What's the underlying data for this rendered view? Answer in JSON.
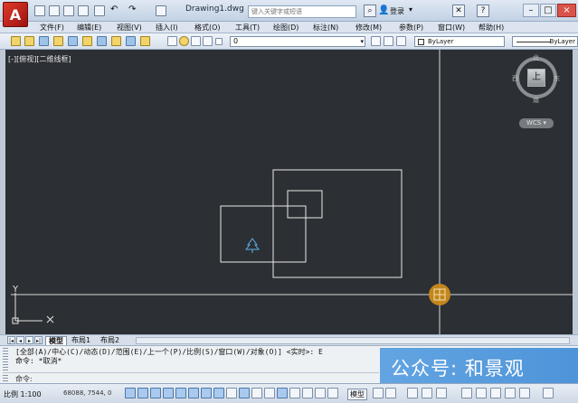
{
  "app": {
    "logo": "A",
    "document_title": "Drawing1.dwg"
  },
  "search": {
    "placeholder": "键入关键字或短语"
  },
  "user": {
    "login_label": "登录",
    "icon": "user-icon"
  },
  "menu": [
    "文件(F)",
    "编辑(E)",
    "视图(V)",
    "插入(I)",
    "格式(O)",
    "工具(T)",
    "绘图(D)",
    "标注(N)",
    "修改(M)",
    "参数(P)",
    "窗口(W)",
    "帮助(H)"
  ],
  "toolbar": {
    "layer_value": "0",
    "color_value": "ByLayer",
    "linetype_value": "ByLayer"
  },
  "viewport": {
    "label": "[-][俯视][二维线框]"
  },
  "viewcube": {
    "north": "北",
    "south": "南",
    "east": "东",
    "west": "西",
    "face": "上",
    "wcs_label": "WCS"
  },
  "ucs": {
    "y_label": "Y",
    "x_label": "X"
  },
  "layout_tabs": [
    "模型",
    "布局1",
    "布局2"
  ],
  "command": {
    "history": [
      "[全部(A)/中心(C)/动态(D)/范围(E)/上一个(P)/比例(S)/窗口(W)/对象(O)] <实时>: E",
      "命令: *取消*"
    ],
    "prompt": "命令:",
    "input_value": ""
  },
  "statusbar": {
    "scale": "比例 1:100",
    "coordinates": "68088, 7544, 0",
    "model_label": "模型"
  },
  "watermark": {
    "text": "公众号: 和景观"
  },
  "colors": {
    "canvas_bg": "#2c2f33",
    "crosshair": "#d8d8d8",
    "geometry": "#e8e8e8",
    "tree_block": "#5ab0e8",
    "cursor_marker": "#c98a1c"
  }
}
